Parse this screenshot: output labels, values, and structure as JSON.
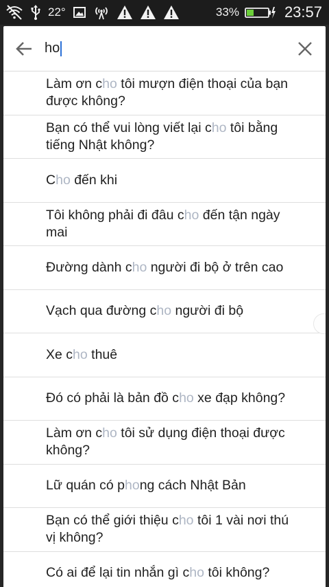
{
  "status_bar": {
    "temperature": "22°",
    "battery_percent": "33%",
    "time": "23:57",
    "icons": [
      "wifi-off-icon",
      "usb-icon",
      "image-icon",
      "hotspot-icon",
      "warning-icon",
      "warning-icon",
      "warning-icon",
      "battery-charging-icon"
    ]
  },
  "search": {
    "query": "ho",
    "back_icon": "arrow-left-icon",
    "clear_icon": "close-icon",
    "highlight_color": "#aeb6c4"
  },
  "results": [
    {
      "parts": [
        "Làm ơn c",
        "ho",
        " tôi mượn điện thoại của bạn được không?"
      ]
    },
    {
      "parts": [
        "Bạn có thể vui lòng viết lại c",
        "ho",
        " tôi bằng tiếng Nhật không?"
      ]
    },
    {
      "parts": [
        "C",
        "ho",
        " đến khi"
      ]
    },
    {
      "parts": [
        "Tôi không phải đi đâu c",
        "ho",
        " đến tận ngày mai"
      ]
    },
    {
      "parts": [
        "Đường dành c",
        "ho",
        " người đi bộ ở trên cao"
      ]
    },
    {
      "parts": [
        "Vạch qua đường c",
        "ho",
        " người đi bộ"
      ]
    },
    {
      "parts": [
        "Xe c",
        "ho",
        " thuê"
      ]
    },
    {
      "parts": [
        "Đó có phải là bản đồ c",
        "ho",
        " xe đạp không?"
      ]
    },
    {
      "parts": [
        "Làm ơn c",
        "ho",
        " tôi sử dụng điện thoại được không?"
      ]
    },
    {
      "parts": [
        "Lữ quán có p",
        "ho",
        "ng cách Nhật Bản"
      ]
    },
    {
      "parts": [
        "Bạn có thể giới thiệu c",
        "ho",
        " tôi 1 vài nơi thú vị không?"
      ]
    },
    {
      "parts": [
        "Có ai để lại tin nhắn gì c",
        "ho",
        " tôi không?"
      ]
    }
  ]
}
